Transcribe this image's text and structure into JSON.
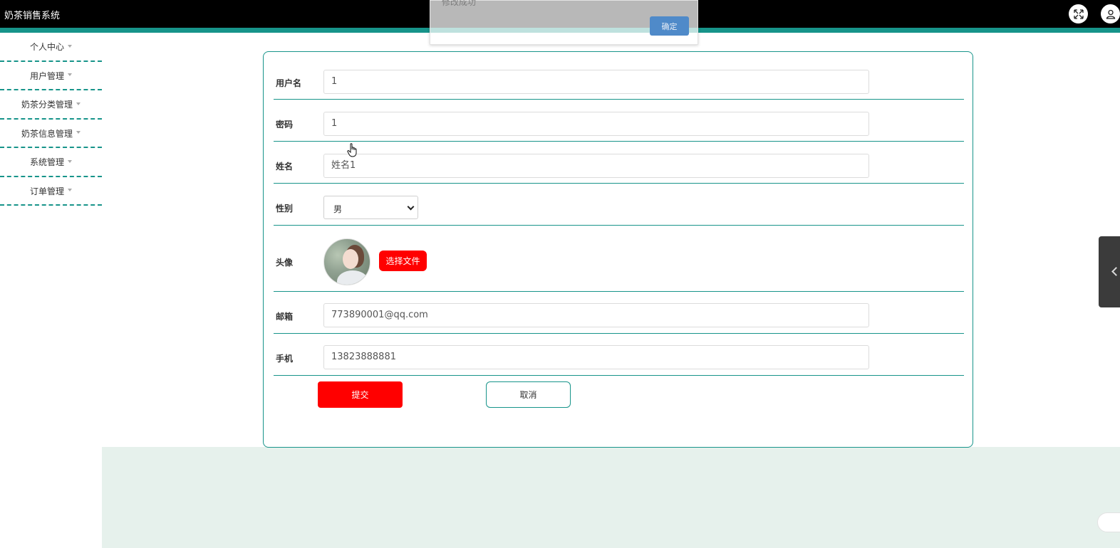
{
  "app": {
    "title": "奶茶销售系统"
  },
  "header": {
    "fullscreen_icon": "expand-icon",
    "user_icon": "user-icon"
  },
  "sidebar": {
    "items": [
      {
        "label": "个人中心"
      },
      {
        "label": "用户管理"
      },
      {
        "label": "奶茶分类管理"
      },
      {
        "label": "奶茶信息管理"
      },
      {
        "label": "系统管理"
      },
      {
        "label": "订单管理"
      }
    ]
  },
  "form": {
    "username": {
      "label": "用户名",
      "value": "1"
    },
    "password": {
      "label": "密码",
      "value": "1"
    },
    "name": {
      "label": "姓名",
      "value": "姓名1"
    },
    "gender": {
      "label": "性别",
      "value": "男"
    },
    "avatar": {
      "label": "头像",
      "button": "选择文件"
    },
    "email": {
      "label": "邮箱",
      "value": "773890001@qq.com"
    },
    "phone": {
      "label": "手机",
      "value": "13823888881"
    },
    "submit_label": "提交",
    "cancel_label": "取消"
  },
  "toast": {
    "message": "修改成功",
    "confirm_label": "确定"
  },
  "colors": {
    "accent": "#17948a",
    "primary_red": "#ff0000",
    "header_bg": "#000000",
    "band_bg": "#e6f1ec"
  }
}
